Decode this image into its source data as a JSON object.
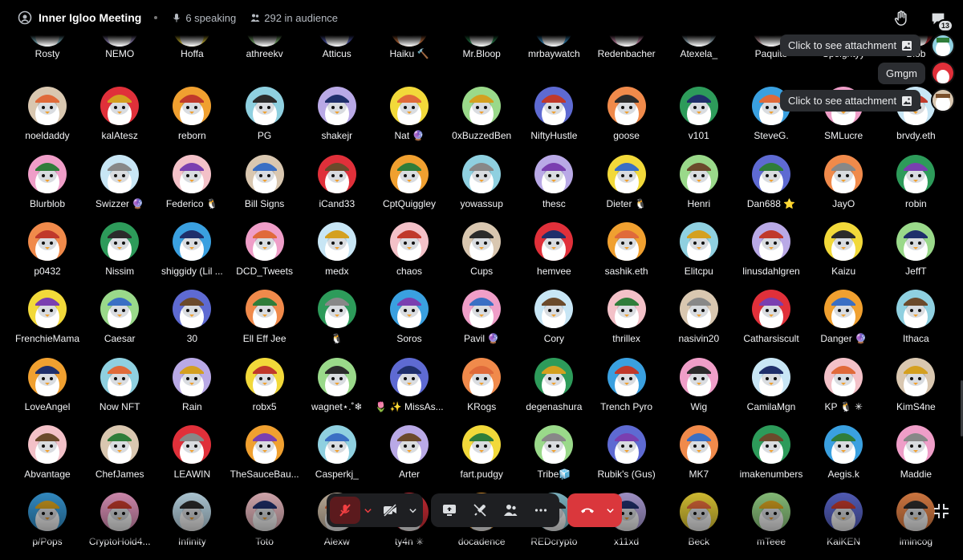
{
  "header": {
    "title": "Inner Igloo Meeting",
    "speaking": "6 speaking",
    "audience": "292 in audience",
    "notification_count": "13"
  },
  "colors": {
    "background": "#000000",
    "leave_button": "#da373c",
    "mic_muted": "#f23f42"
  },
  "toasts": [
    {
      "text": "Click to see attachment",
      "icon": "image-icon"
    },
    {
      "text": "Gmgm"
    },
    {
      "text": "Click to see attachment",
      "icon": "image-icon"
    }
  ],
  "rows": [
    [
      "Rosty",
      "NEMO",
      "Hoffa",
      "athreekv",
      "Atticus",
      "Haiku 🔨",
      "Mr.Bloop",
      "mrbaywatch",
      "Redenbacher",
      "Atexela_",
      "Paquito",
      "Speightyy",
      "Blob"
    ],
    [
      "noeldaddy",
      "kalAtesz",
      "reborn",
      "PG",
      "shakejr",
      "Nat 🔮",
      "0xBuzzedBen",
      "NiftyHustle",
      "goose",
      "v101",
      "SteveG.",
      "SMLucre",
      "brvdy.eth"
    ],
    [
      "Blurblob",
      "Swizzer 🔮",
      "Federico 🐧",
      "Bill Signs",
      "iCand33",
      "CptQuiggley",
      "yowassup",
      "thesc",
      "Dieter 🐧",
      "Henri",
      "Dan688 ⭐",
      "JayO",
      "robin"
    ],
    [
      "p0432",
      "Nissim",
      "shiggidy (Lil ...",
      "DCD_Tweets",
      "medx",
      "chaos",
      "Cups",
      "hemvee",
      "sashik.eth",
      "Elitcpu",
      "linusdahlgren",
      "Kaizu",
      "JeffT"
    ],
    [
      "FrenchieMama",
      "Caesar",
      "30",
      "Ell Eff Jee",
      "🐧",
      "Soros",
      "Pavil 🔮",
      "Cory",
      "thrillex",
      "nasivin20",
      "Catharsiscult",
      "Danger 🔮",
      "Ithaca"
    ],
    [
      "LoveAngel",
      "Now NFT",
      "Rain",
      "robx5",
      "wagnet⋆.˚❄",
      "🌷 ✨ MissAs...",
      "KRogs",
      "degenashura",
      "Trench Pyro",
      "Wig",
      "CamilaMgn",
      "KP 🐧 ✳",
      "KimS4ne"
    ],
    [
      "Abvantage",
      "ChefJames",
      "LEAWIN",
      "TheSauceBau...",
      "Casperkj_",
      "Arter",
      "fart.pudgy",
      "Tribe🧊",
      "Rubik's (Gus)",
      "MK7",
      "imakenumbers",
      "Aegis.k",
      "Maddie"
    ],
    [
      "p/Pops",
      "CryptoHold4...",
      "Infinity",
      "Toto",
      "Alexw",
      "ty4n ✳",
      "docadence",
      "REDcrypto",
      "x11xd",
      "Beck",
      "mTeee",
      "KaiKEN",
      "imincog"
    ]
  ]
}
